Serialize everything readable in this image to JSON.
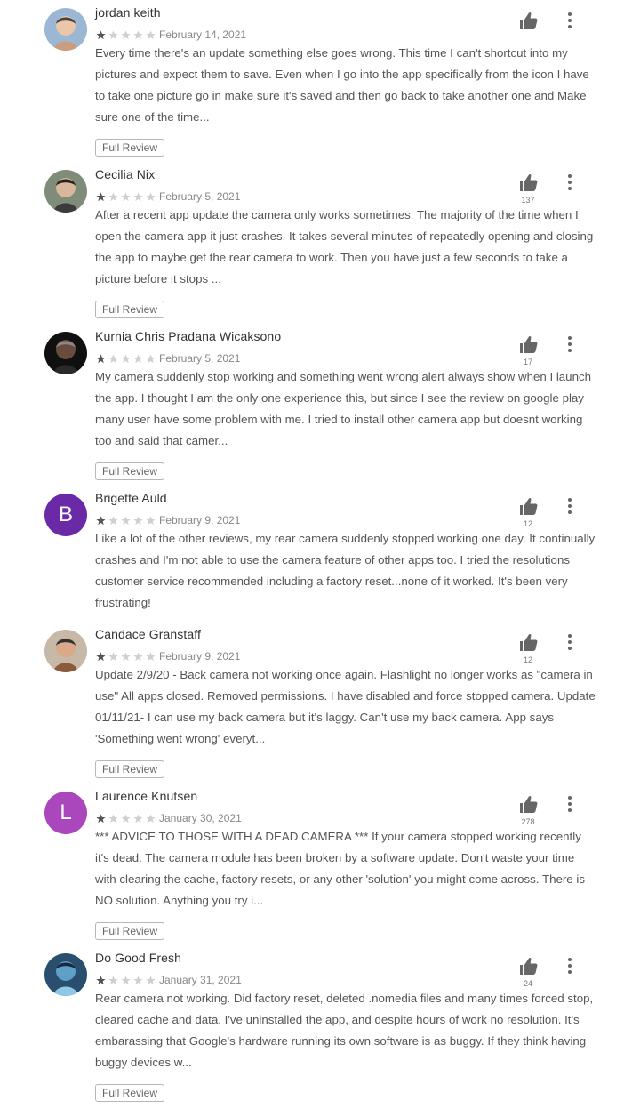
{
  "colors": {
    "star_filled": "#555555",
    "star_empty": "#d0d0d0",
    "thumb": "#666666"
  },
  "full_review_label": "Full Review",
  "reviews": [
    {
      "name": "jordan keith",
      "date": "February 14, 2021",
      "rating": 1,
      "likes": "",
      "avatar": {
        "type": "photo",
        "description": "two people with sunglasses"
      },
      "text": "Every time there's an update something else goes wrong. This time I can't shortcut into my pictures and expect them to save. Even when I go into the app specifically from the icon I have to take one picture go in make sure it's saved and then go back to take another one and Make sure one of the time...",
      "has_full_review": true
    },
    {
      "name": "Cecilia Nix",
      "date": "February 5, 2021",
      "rating": 1,
      "likes": "137",
      "avatar": {
        "type": "photo",
        "description": "woman with glasses"
      },
      "text": "After a recent app update the camera only works sometimes. The majority of the time when I open the camera app it just crashes. It takes several minutes of repeatedly opening and closing the app to maybe get the rear camera to work. Then you have just a few seconds to take a picture before it stops ...",
      "has_full_review": true
    },
    {
      "name": "Kurnia Chris Pradana Wicaksono",
      "date": "February 5, 2021",
      "rating": 1,
      "likes": "17",
      "avatar": {
        "type": "photo",
        "description": "person in dark photo"
      },
      "text": "My camera suddenly stop working and something went wrong alert always show when I launch the app. I thought I am the only one experience this, but since I see the review on google play many user have some problem with me. I tried to install other camera app but doesnt working too and said that camer...",
      "has_full_review": true
    },
    {
      "name": "Brigette Auld",
      "date": "February 9, 2021",
      "rating": 1,
      "likes": "12",
      "avatar": {
        "type": "letter",
        "letter": "B",
        "color": "#6a2aa8"
      },
      "text": "Like a lot of the other reviews, my rear camera suddenly stopped working one day. It continually crashes and I'm not able to use the camera feature of other apps too. I tried the resolutions customer service recommended including a factory reset...none of it worked. It's been very frustrating!",
      "has_full_review": false
    },
    {
      "name": "Candace Granstaff",
      "date": "February 9, 2021",
      "rating": 1,
      "likes": "12",
      "avatar": {
        "type": "photo",
        "description": "woman smiling"
      },
      "text": "Update 2/9/20 - Back camera not working once again. Flashlight no longer works as \"camera in use\" All apps closed. Removed permissions. I have disabled and force stopped camera. Update 01/11/21- I can use my back camera but it's laggy. Can't use my back camera. App says 'Something went wrong' everyt...",
      "has_full_review": true
    },
    {
      "name": "Laurence Knutsen",
      "date": "January 30, 2021",
      "rating": 1,
      "likes": "278",
      "avatar": {
        "type": "letter",
        "letter": "L",
        "color": "#ab47bc"
      },
      "text": "*** ADVICE TO THOSE WITH A DEAD CAMERA *** If your camera stopped working recently it's dead. The camera module has been broken by a software update. Don't waste your time with clearing the cache, factory resets, or any other 'solution' you might come across. There is NO solution. Anything you try i...",
      "has_full_review": true
    },
    {
      "name": "Do Good Fresh",
      "date": "January 31, 2021",
      "rating": 1,
      "likes": "24",
      "avatar": {
        "type": "photo",
        "description": "blue abstract artwork"
      },
      "text": "Rear camera not working. Did factory reset, deleted .nomedia files and many times forced stop, cleared cache and data. I've uninstalled the app, and despite hours of work no resolution. It's embarassing that Google's hardware running its own software is as buggy. If they think having buggy devices w...",
      "has_full_review": true
    }
  ]
}
